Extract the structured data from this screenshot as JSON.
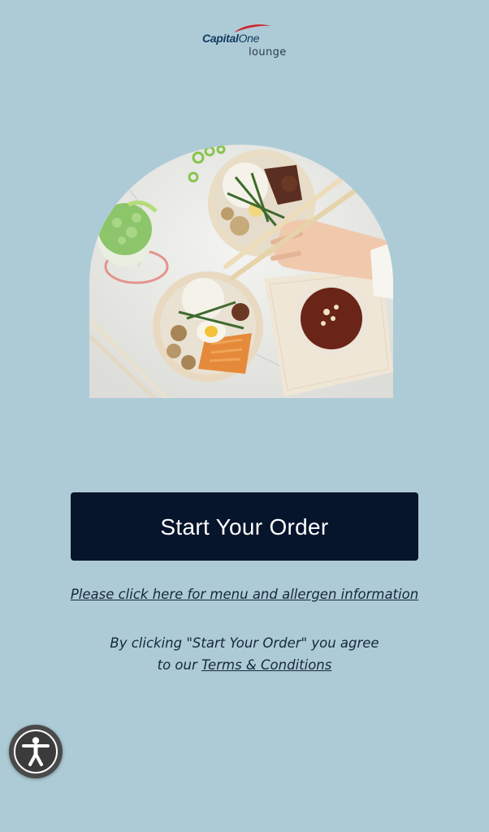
{
  "brand": {
    "name_part1": "Capital",
    "name_part2": "One",
    "subtitle": "lounge",
    "swoosh_color": "#d0212a",
    "text_color": "#0f3a5f"
  },
  "hero_image": {
    "icon": "food-bowls-illustration"
  },
  "cta": {
    "label": "Start Your Order",
    "bg_color": "#06152b"
  },
  "links": {
    "menu_info": "Please click here for menu and allergen information"
  },
  "agreement": {
    "line1": "By clicking \"Start Your Order\" you agree",
    "line2_prefix": "to our ",
    "terms_label": "Terms & Conditions"
  },
  "accessibility": {
    "icon": "accessibility-icon"
  },
  "theme": {
    "background": "#adcbd6"
  }
}
